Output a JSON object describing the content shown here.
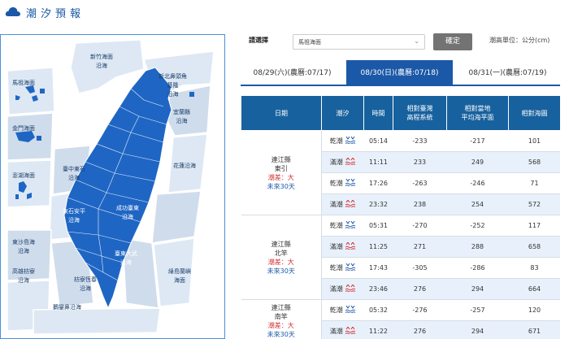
{
  "header": {
    "title": "潮汐預報",
    "logo_icon": "cloud-icon"
  },
  "map": {
    "zones": [
      {
        "id": "hsinchu",
        "label": "新竹海面\n沿海"
      },
      {
        "id": "matsu",
        "label": "馬祖海面"
      },
      {
        "id": "keelung-n",
        "label": "新北鼻頭角\n基隆\n沿海"
      },
      {
        "id": "kinmen",
        "label": "金門海面"
      },
      {
        "id": "yilan",
        "label": "宜蘭縣\n沿海"
      },
      {
        "id": "taichung",
        "label": "臺中東石\n沿海"
      },
      {
        "id": "penghu",
        "label": "澎湖海面"
      },
      {
        "id": "hualien",
        "label": "花蓮沿海"
      },
      {
        "id": "anping",
        "label": "東石安平\n沿海"
      },
      {
        "id": "chenggong",
        "label": "成功臺東\n沿海"
      },
      {
        "id": "dongsha",
        "label": "東沙島海\n沿海"
      },
      {
        "id": "kaohsiung",
        "label": "高雄枋寮\n沿海"
      },
      {
        "id": "taitung",
        "label": "臺東大武\n沿海"
      },
      {
        "id": "lanyu",
        "label": "綠島蘭嶼\n海面"
      },
      {
        "id": "hengchun",
        "label": "枋寮恆春\n沿海"
      },
      {
        "id": "eluanbi",
        "label": "鵝鑾鼻沿海"
      }
    ],
    "colors": {
      "land": "#1f66c4",
      "sea_zone": "#dde8f4",
      "sea_zone_dark": "#cfdcec",
      "border": "#4a90d9"
    }
  },
  "controls": {
    "select_label": "請選擇",
    "select_value": "馬祖海面",
    "confirm_label": "確定",
    "unit_text": "潮高單位：公分(cm)"
  },
  "tabs": [
    {
      "label": "08/29(六)(農曆:07/17)",
      "active": false
    },
    {
      "label": "08/30(日)(農曆:07/18)",
      "active": true
    },
    {
      "label": "08/31(一)(農曆:07/19)",
      "active": false
    }
  ],
  "table": {
    "headers": [
      "日期",
      "潮汐",
      "時間",
      "相對臺灣\n高程系統",
      "相對當地\n平均海平面",
      "相對海圖"
    ],
    "groups": [
      {
        "county": "連江縣",
        "town": "東引",
        "tide_size": "潮差：大",
        "future": "未來30天",
        "rows": [
          {
            "tide": "乾潮",
            "icon": "low-tide-icon",
            "time": "05:14",
            "twvd": "-233",
            "msl": "-217",
            "chart": "101"
          },
          {
            "tide": "滿潮",
            "icon": "high-tide-icon",
            "time": "11:11",
            "twvd": "233",
            "msl": "249",
            "chart": "568"
          },
          {
            "tide": "乾潮",
            "icon": "low-tide-icon",
            "time": "17:26",
            "twvd": "-263",
            "msl": "-246",
            "chart": "71"
          },
          {
            "tide": "滿潮",
            "icon": "high-tide-icon",
            "time": "23:32",
            "twvd": "238",
            "msl": "254",
            "chart": "572"
          }
        ]
      },
      {
        "county": "連江縣",
        "town": "北竿",
        "tide_size": "潮差：大",
        "future": "未來30天",
        "rows": [
          {
            "tide": "乾潮",
            "icon": "low-tide-icon",
            "time": "05:31",
            "twvd": "-270",
            "msl": "-252",
            "chart": "117"
          },
          {
            "tide": "滿潮",
            "icon": "high-tide-icon",
            "time": "11:25",
            "twvd": "271",
            "msl": "288",
            "chart": "658"
          },
          {
            "tide": "乾潮",
            "icon": "low-tide-icon",
            "time": "17:43",
            "twvd": "-305",
            "msl": "-286",
            "chart": "83"
          },
          {
            "tide": "滿潮",
            "icon": "high-tide-icon",
            "time": "23:46",
            "twvd": "276",
            "msl": "294",
            "chart": "664"
          }
        ]
      },
      {
        "county": "連江縣",
        "town": "南竿",
        "tide_size": "潮差：大",
        "future": "未來30天",
        "rows": [
          {
            "tide": "乾潮",
            "icon": "low-tide-icon",
            "time": "05:32",
            "twvd": "-276",
            "msl": "-257",
            "chart": "120"
          },
          {
            "tide": "滿潮",
            "icon": "high-tide-icon",
            "time": "11:22",
            "twvd": "276",
            "msl": "294",
            "chart": "671"
          }
        ]
      }
    ]
  }
}
